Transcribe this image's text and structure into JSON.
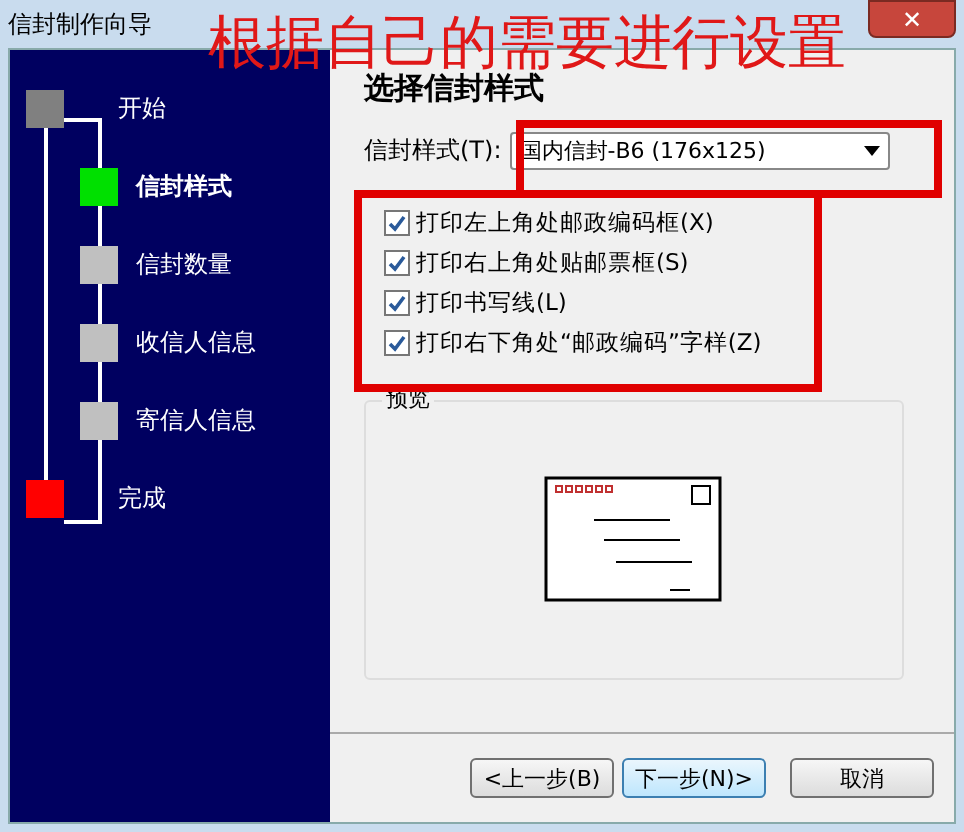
{
  "window": {
    "title": "信封制作向导",
    "close": "✕"
  },
  "annotation": {
    "text": "根据自己的需要进行设置"
  },
  "steps": [
    {
      "label": "开始",
      "kind": "start",
      "color": "#808080",
      "selected": false
    },
    {
      "label": "信封样式",
      "kind": "step",
      "color": "#00e000",
      "selected": true
    },
    {
      "label": "信封数量",
      "kind": "step",
      "color": "#c0c0c0",
      "selected": false
    },
    {
      "label": "收信人信息",
      "kind": "step",
      "color": "#c0c0c0",
      "selected": false
    },
    {
      "label": "寄信人信息",
      "kind": "step",
      "color": "#c0c0c0",
      "selected": false
    },
    {
      "label": "完成",
      "kind": "finish",
      "color": "#ff0000",
      "selected": false
    }
  ],
  "page": {
    "heading": "选择信封样式",
    "style_label": "信封样式(T):",
    "style_value": "国内信封-B6 (176x125)",
    "options": [
      {
        "label": "打印左上角处邮政编码框(X)",
        "checked": true
      },
      {
        "label": "打印右上角处贴邮票框(S)",
        "checked": true
      },
      {
        "label": "打印书写线(L)",
        "checked": true
      },
      {
        "label": "打印右下角处“邮政编码”字样(Z)",
        "checked": true
      }
    ],
    "preview_label": "预览"
  },
  "buttons": [
    {
      "label": "<上一步(B)",
      "kind": "back"
    },
    {
      "label": "下一步(N)>",
      "kind": "next"
    },
    {
      "label": "取消",
      "kind": "cancel"
    }
  ]
}
